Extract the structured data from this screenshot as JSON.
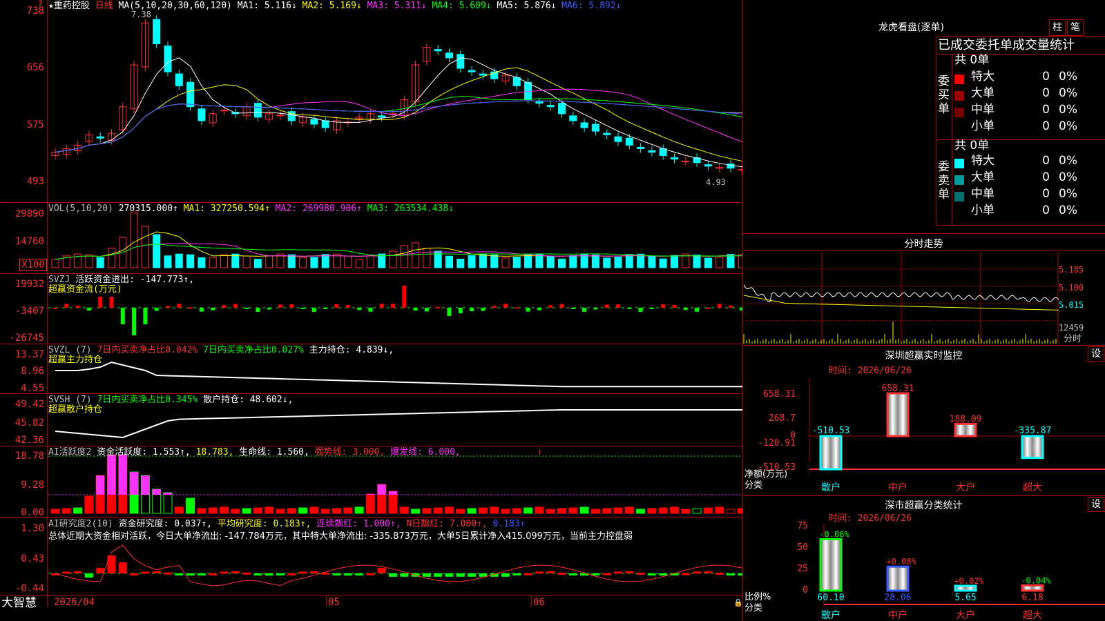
{
  "header": {
    "star": "★",
    "stock_name": "重药控股",
    "period": "日线",
    "ma_label": "MA(5,10,20,30,60,120)",
    "ma1": "MA1: 5.116↓",
    "ma2": "MA2: 5.169↓",
    "ma3": "MA3: 5.311↓",
    "ma4": "MA4: 5.609↓",
    "ma5": "MA5: 5.876↓",
    "ma6": "MA6: 5.892↓",
    "high_mark": "7.38",
    "low_mark": "4.93",
    "question": "?"
  },
  "price_axis": [
    "738",
    "656",
    "575",
    "493"
  ],
  "vol": {
    "label": "VOL(5,10,20)",
    "value": "270315.000↑",
    "ma1": "MA1: 327250.594↑",
    "ma2": "MA2: 269980.906↑",
    "ma3": "MA3: 263534.438↓",
    "axis": [
      "29890",
      "14760",
      "X100"
    ]
  },
  "svzj": {
    "label": "SVZJ",
    "text": "活跃资金进出: -147.773↑,",
    "sub": "超赢资金流(万元)",
    "axis": [
      "19932",
      "-3407",
      "-26745"
    ]
  },
  "svzl": {
    "label": "SVZL (7)",
    "t1": "7日内买卖净占比0.042%",
    "t2": "7日内买卖净占比0.027%",
    "t3": "主力持仓: 4.839↓,",
    "sub": "超赢主力持仓",
    "axis": [
      "13.37",
      "8.96",
      "4.55"
    ]
  },
  "svsh": {
    "label": "SVSH (7)",
    "t1": "7日内买卖净占比0.345%",
    "t2": "散户持仓: 48.602↓,",
    "sub": "超赢散户持仓",
    "axis": [
      "49.42",
      "45.82",
      "42.36"
    ]
  },
  "ai1": {
    "label": "AI活跃度2",
    "t1": "资金活跃度: 1.553↑,",
    "t2": "18.783,",
    "t3": "生命线: 1.560,",
    "t4": "强势线: 3.000,",
    "t5": "爆发线: 6.000,",
    "axis": [
      "18.78",
      "9.28",
      "0.00"
    ]
  },
  "ai2": {
    "label": "AI研究度2(10)",
    "t1": "资金研究度: 0.037↑,",
    "t2": "平均研究度: 0.183↑,",
    "t3": "连续飘红: 1.000↑,",
    "t4": "N日飘红: 7.000↑,",
    "t5": "0.183↑",
    "summary": "总体近期大资金相对活跃，今日大单净流出: -147.784万元，其中特大单净流出: -335.873万元，大单5日累计净入415.099万元，当前主力控盘弱",
    "axis": [
      "1.30",
      "0.43",
      "-0.44"
    ]
  },
  "x_axis": {
    "brand": "大智慧",
    "date": "2026/04",
    "m05": "05",
    "m06": "06"
  },
  "right": {
    "lhb_title": "龙虎看盘(逐单)",
    "btn_zhu": "柱",
    "btn_bi": "笔",
    "stat_title": "已成交委托单成交量统计",
    "buy_label": "委买单",
    "sell_label": "委卖单",
    "buy_total": "共 0单",
    "sell_total": "共 0单",
    "buy_rows": [
      {
        "name": "特大",
        "val": "0",
        "pct": "0%",
        "color": "#ff0000"
      },
      {
        "name": "大单",
        "val": "0",
        "pct": "0%",
        "color": "#a00000"
      },
      {
        "name": "中单",
        "val": "0",
        "pct": "0%",
        "color": "#780000"
      },
      {
        "name": "小单",
        "val": "0",
        "pct": "0%",
        "color": "#000000"
      }
    ],
    "sell_rows": [
      {
        "name": "特大",
        "val": "0",
        "pct": "0%",
        "color": "#00ffff"
      },
      {
        "name": "大单",
        "val": "0",
        "pct": "0%",
        "color": "#009c9c"
      },
      {
        "name": "中单",
        "val": "0",
        "pct": "0%",
        "color": "#007070"
      },
      {
        "name": "小单",
        "val": "0",
        "pct": "0%",
        "color": "#000000"
      }
    ],
    "fs_title": "分时走势",
    "fs_axis": [
      "5.185",
      "5.100",
      "5.015",
      "12459"
    ],
    "fs_unit": "分时",
    "sz_title": "深圳超赢实时监控",
    "sz_btn": "设",
    "sz_time": "时间: 2026/06/26",
    "sz_axis": [
      "658.31",
      "268.7",
      "0",
      "-120.91",
      "-510.53"
    ],
    "sz_ylabel": "净额(万元)",
    "sz_xlabel": "分类",
    "sz_values": [
      "-510.53",
      "658.31",
      "188.09",
      "-335.87"
    ],
    "sz_cats": [
      "散户",
      "中户",
      "大户",
      "超大"
    ],
    "ss_title": "深市超赢分类统计",
    "ss_btn": "设",
    "ss_time": "时间: 2026/06/26",
    "ss_axis": [
      "75",
      "50",
      "25",
      "0"
    ],
    "ss_ylabel": "比例%",
    "ss_xlabel": "分类",
    "ss_changes": [
      "-0.06%",
      "+0.08%",
      "+0.02%",
      "-0.04%"
    ],
    "ss_values": [
      "60.10",
      "28.06",
      "5.65",
      "6.18"
    ],
    "ss_cats": [
      "散户",
      "中户",
      "大户",
      "超大"
    ]
  }
}
